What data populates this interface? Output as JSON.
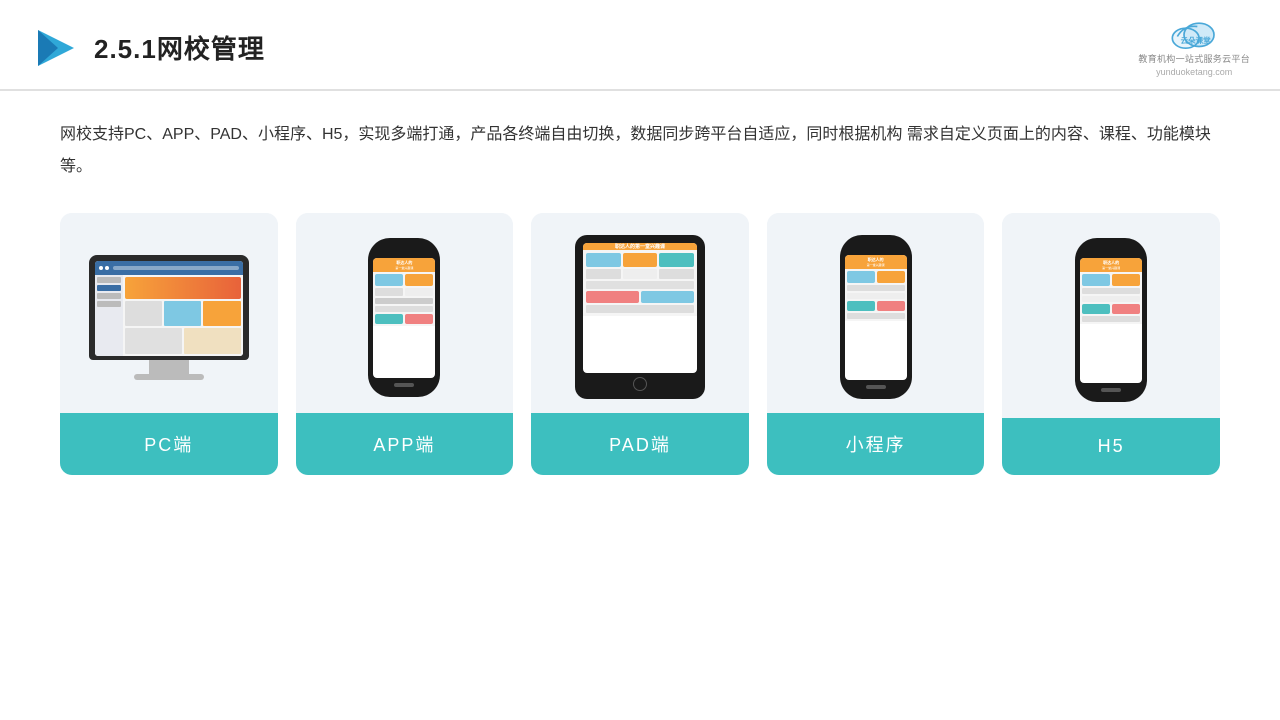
{
  "header": {
    "title": "2.5.1网校管理",
    "brand_name": "云朵课堂",
    "brand_url": "yunduoketang.com",
    "brand_sub": "教育机构一站\n式服务云平台"
  },
  "description": "网校支持PC、APP、PAD、小程序、H5，实现多端打通，产品各终端自由切换，数据同步跨平台自适应，同时根据机构\n需求自定义页面上的内容、课程、功能模块等。",
  "cards": [
    {
      "id": "pc",
      "label": "PC端"
    },
    {
      "id": "app",
      "label": "APP端"
    },
    {
      "id": "pad",
      "label": "PAD端"
    },
    {
      "id": "mini",
      "label": "小程序"
    },
    {
      "id": "h5",
      "label": "H5"
    }
  ],
  "colors": {
    "teal": "#3dbfbf",
    "card_bg": "#f0f4f8",
    "accent_blue": "#3a6ea5",
    "accent_orange": "#f7a33a"
  }
}
